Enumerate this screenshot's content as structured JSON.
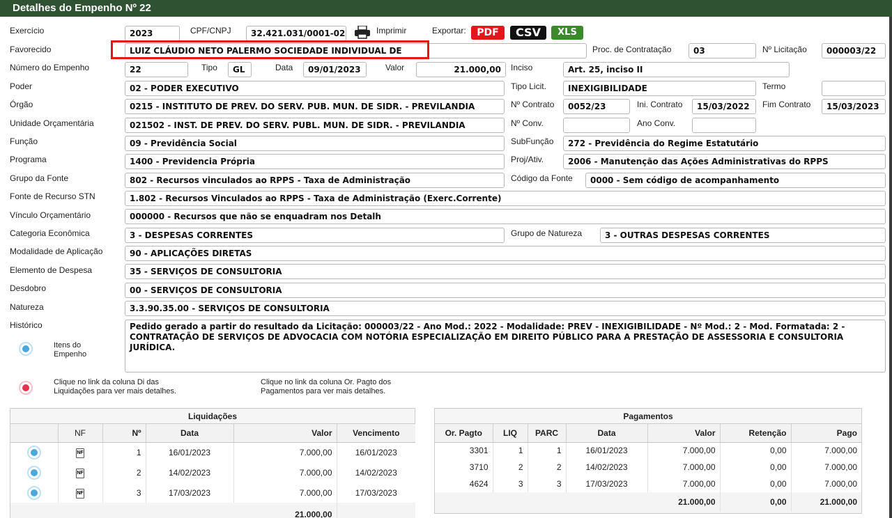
{
  "window": {
    "title": "Detalhes do Empenho Nº 22"
  },
  "header": {
    "exercicio_label": "Exercício",
    "exercicio": "2023",
    "cpf_label": "CPF/CNPJ",
    "cpf": "32.421.031/0001-02",
    "print_label": "Imprimir",
    "export_label": "Exportar:",
    "export_pdf": "PDF",
    "export_csv": "CSV",
    "export_xls": "XLS"
  },
  "fields": {
    "favorecido_label": "Favorecido",
    "favorecido": "LUIZ CLÁUDIO NETO PALERMO SOCIEDADE INDIVIDUAL DE",
    "proc_label": "Proc. de Contratação",
    "proc": "03",
    "licitacao_label": "Nº Licitação",
    "licitacao": "000003/22",
    "numero_label": "Número do Empenho",
    "numero": "22",
    "tipo_label": "Tipo",
    "tipo": "GL",
    "data_label": "Data",
    "data": "09/01/2023",
    "valor_label": "Valor",
    "valor": "21.000,00",
    "inciso_label": "Inciso",
    "inciso": "Art. 25, inciso II",
    "poder_label": "Poder",
    "poder": "02 - PODER EXECUTIVO",
    "tipo_licit_label": "Tipo Licit.",
    "tipo_licit": "INEXIGIBILIDADE",
    "termo_label": "Termo",
    "termo": "",
    "orgao_label": "Órgão",
    "orgao": "0215 - INSTITUTO DE PREV. DO SERV. PUB. MUN. DE SIDR. - PREVILANDIA",
    "contrato_label": "Nº Contrato",
    "contrato": "0052/23",
    "ini_contrato_label": "Ini. Contrato",
    "ini_contrato": "15/03/2022",
    "fim_contrato_label": "Fim Contrato",
    "fim_contrato": "15/03/2023",
    "unidade_label": "Unidade Orçamentária",
    "unidade": "021502 - INST. DE PREV. DO SERV. PUBL. MUN. DE SIDR. - PREVILANDIA",
    "conv_label": "Nº Conv.",
    "conv": "",
    "ano_conv_label": "Ano Conv.",
    "ano_conv": "",
    "funcao_label": "Função",
    "funcao": "09 - Previdência Social",
    "subfuncao_label": "SubFunção",
    "subfuncao": "272 - Previdência do Regime Estatutário",
    "programa_label": "Programa",
    "programa": "1400 - Previdencia Própria",
    "proj_label": "Proj/Ativ.",
    "proj": "2006 - Manutenção das Ações Administrativas do RPPS",
    "grupo_fonte_label": "Grupo da Fonte",
    "grupo_fonte": "802 - Recursos vinculados ao RPPS - Taxa de Administração",
    "codigo_fonte_label": "Código da Fonte",
    "codigo_fonte": "0000 - Sem código de acompanhamento",
    "fonte_stn_label": "Fonte de Recurso STN",
    "fonte_stn": "1.802 - Recursos Vinculados ao RPPS - Taxa de Administração (Exerc.Corrente)",
    "vinculo_label": "Vínculo Orçamentário",
    "vinculo": "000000 - Recursos que não se enquadram nos Detalh",
    "categoria_label": "Categoria Econômica",
    "categoria": "3 - DESPESAS CORRENTES",
    "grupo_natureza_label": "Grupo de Natureza",
    "grupo_natureza": "3 - OUTRAS DESPESAS CORRENTES",
    "modalidade_label": "Modalidade de Aplicação",
    "modalidade": "90 - APLICAÇÕES DIRETAS",
    "elemento_label": "Elemento de Despesa",
    "elemento": "35 - SERVIÇOS DE CONSULTORIA",
    "desdobro_label": "Desdobro",
    "desdobro": "00 - SERVIÇOS DE CONSULTORIA",
    "natureza_label": "Natureza",
    "natureza": "3.3.90.35.00 - SERVIÇOS DE CONSULTORIA",
    "historico_label": "Histórico",
    "historico": "Pedido gerado a partir do resultado da Licitação: 000003/22 - Ano Mod.: 2022 - Modalidade: PREV - INEXIGIBILIDADE - Nº Mod.: 2 - Mod. Formatada: 2 - CONTRATAÇÃO DE SERVIÇOS DE ADVOCACIA COM NOTÓRIA ESPECIALIZAÇÃO EM DIREITO PÚBLICO PARA A PRESTAÇÃO DE ASSESSORIA E CONSULTORIA JURÍDICA."
  },
  "hints": {
    "itens_line1": "Itens do",
    "itens_line2": "Empenho",
    "liq_hint_line1": "Clique no link da coluna Di das",
    "liq_hint_line2": "Liquidações para ver mais detalhes.",
    "pag_hint_line1": "Clique no link da coluna Or. Pagto dos",
    "pag_hint_line2": "Pagamentos para ver mais detalhes."
  },
  "liquidacoes": {
    "title": "Liquidações",
    "headers": [
      "",
      "NF",
      "Nº",
      "Data",
      "Valor",
      "Vencimento"
    ],
    "nf_icon_text": "NF",
    "rows": [
      {
        "n": "1",
        "data": "16/01/2023",
        "valor": "7.000,00",
        "venc": "16/01/2023"
      },
      {
        "n": "2",
        "data": "14/02/2023",
        "valor": "7.000,00",
        "venc": "14/02/2023"
      },
      {
        "n": "3",
        "data": "17/03/2023",
        "valor": "7.000,00",
        "venc": "17/03/2023"
      }
    ],
    "total_valor": "21.000,00"
  },
  "pagamentos": {
    "title": "Pagamentos",
    "headers": [
      "Or. Pagto",
      "LIQ",
      "PARC",
      "Data",
      "Valor",
      "Retenção",
      "Pago"
    ],
    "rows": [
      {
        "or": "3301",
        "liq": "1",
        "parc": "1",
        "data": "16/01/2023",
        "valor": "7.000,00",
        "ret": "0,00",
        "pago": "7.000,00"
      },
      {
        "or": "3710",
        "liq": "2",
        "parc": "2",
        "data": "14/02/2023",
        "valor": "7.000,00",
        "ret": "0,00",
        "pago": "7.000,00"
      },
      {
        "or": "4624",
        "liq": "3",
        "parc": "3",
        "data": "17/03/2023",
        "valor": "7.000,00",
        "ret": "0,00",
        "pago": "7.000,00"
      }
    ],
    "total_valor": "21.000,00",
    "total_ret": "0,00",
    "total_pago": "21.000,00"
  }
}
